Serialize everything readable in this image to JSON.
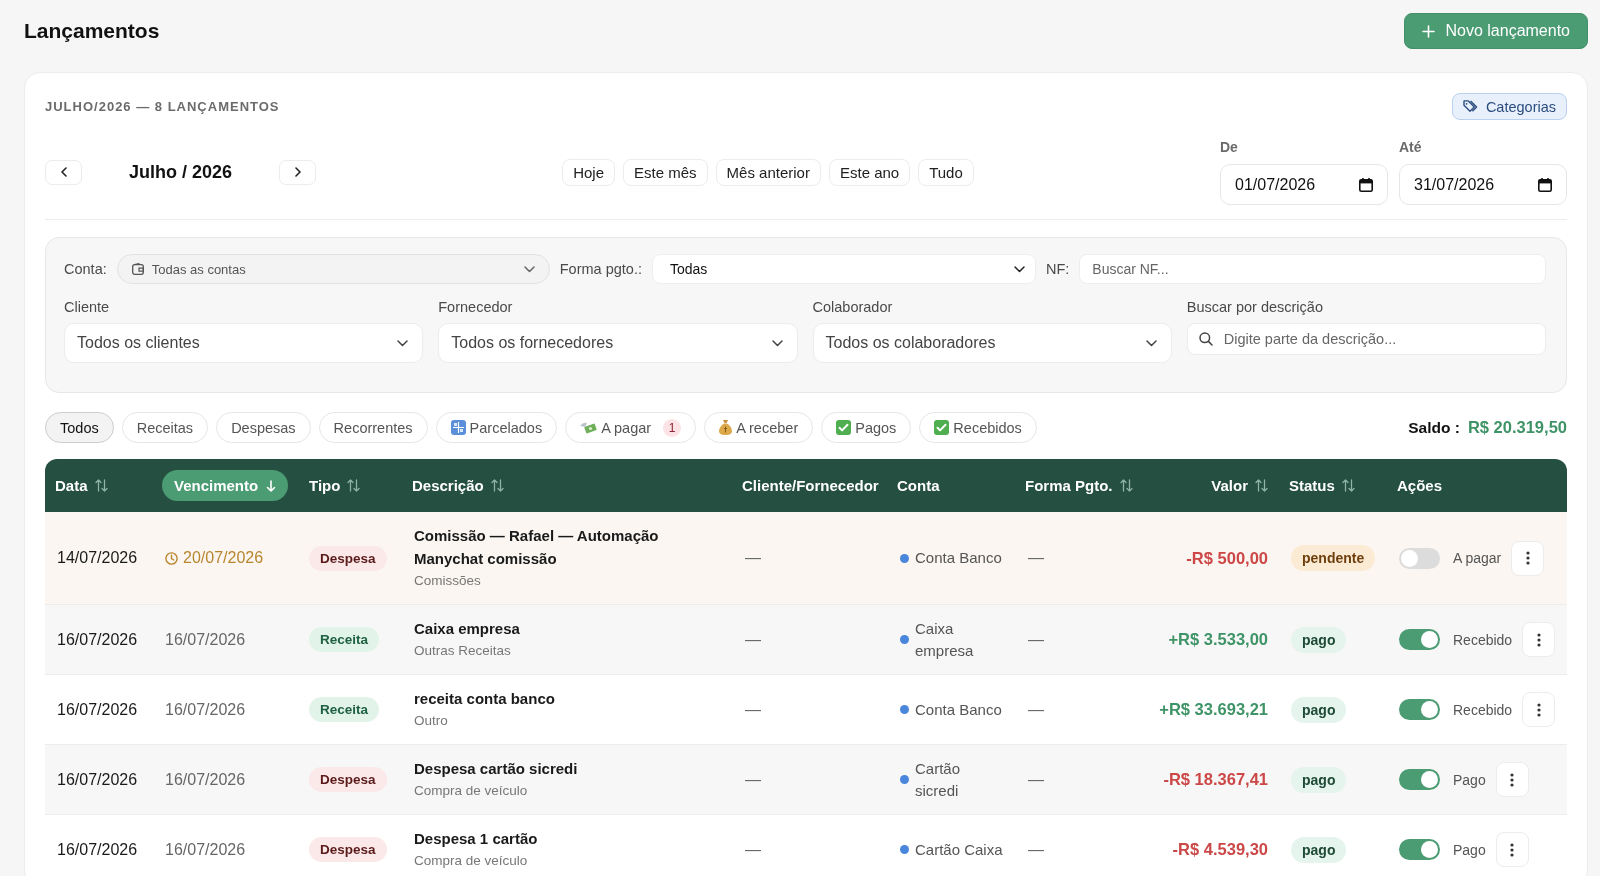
{
  "header": {
    "title": "Lançamentos",
    "new_button": "Novo lançamento"
  },
  "summary": "JULHO/2026 — 8 LANÇAMENTOS",
  "categories_button": "Categorias",
  "period": {
    "label": "Julho / 2026"
  },
  "quick_ranges": [
    "Hoje",
    "Este mês",
    "Mês anterior",
    "Este ano",
    "Tudo"
  ],
  "date_from": {
    "label": "De",
    "value": "01/07/2026"
  },
  "date_to": {
    "label": "Até",
    "value": "31/07/2026"
  },
  "filters": {
    "conta": {
      "label": "Conta:",
      "value": "Todas as contas"
    },
    "forma_pgto": {
      "label": "Forma pgto.:",
      "value": "Todas"
    },
    "nf": {
      "label": "NF:",
      "placeholder": "Buscar NF..."
    },
    "selects": [
      {
        "label": "Cliente",
        "value": "Todos os clientes"
      },
      {
        "label": "Fornecedor",
        "value": "Todos os fornecedores"
      },
      {
        "label": "Colaborador",
        "value": "Todos os colaboradores"
      }
    ],
    "busca": {
      "label": "Buscar por descrição",
      "placeholder": "Digite parte da descrição..."
    }
  },
  "chips": [
    {
      "label": "Todos",
      "kind": "plain",
      "selected": true
    },
    {
      "label": "Receitas",
      "kind": "plain",
      "selected": false
    },
    {
      "label": "Despesas",
      "kind": "plain",
      "selected": false
    },
    {
      "label": "Recorrentes",
      "kind": "plain",
      "selected": false
    },
    {
      "label": "Parcelados",
      "kind": "numbers",
      "selected": false
    },
    {
      "label": "A pagar",
      "kind": "money-wings",
      "selected": false,
      "badge": "1"
    },
    {
      "label": "A receber",
      "kind": "money-bag",
      "selected": false
    },
    {
      "label": "Pagos",
      "kind": "check",
      "selected": false
    },
    {
      "label": "Recebidos",
      "kind": "check",
      "selected": false
    }
  ],
  "saldo": {
    "label": "Saldo :",
    "value": "R$ 20.319,50"
  },
  "table": {
    "columns": [
      {
        "label": "Data",
        "sortable": true,
        "selected": false
      },
      {
        "label": "Vencimento",
        "sortable": true,
        "selected": true
      },
      {
        "label": "Tipo",
        "sortable": true,
        "selected": false
      },
      {
        "label": "Descrição",
        "sortable": true,
        "selected": false
      },
      {
        "label": "Cliente/Fornecedor",
        "sortable": false,
        "selected": false
      },
      {
        "label": "Conta",
        "sortable": false,
        "selected": false
      },
      {
        "label": "Forma Pgto.",
        "sortable": true,
        "selected": false
      },
      {
        "label": "Valor",
        "sortable": true,
        "selected": false
      },
      {
        "label": "Status",
        "sortable": true,
        "selected": false
      },
      {
        "label": "Ações",
        "sortable": false,
        "selected": false
      }
    ],
    "rows": [
      {
        "data": "14/07/2026",
        "vencimento": "20/07/2026",
        "alert": true,
        "kind": "expense",
        "tipo": "Despesa",
        "descricao": "Comissão — Rafael — Automação Manychat comissão",
        "categoria": "Comissões",
        "cliente_fornecedor": "—",
        "conta": "Conta Banco",
        "forma_pgto": "—",
        "valor": "-R$ 500,00",
        "status": {
          "label": "pendente",
          "kind": "pending"
        },
        "paid": false,
        "acao": "A pagar"
      },
      {
        "data": "16/07/2026",
        "vencimento": "16/07/2026",
        "alert": false,
        "kind": "income",
        "tipo": "Receita",
        "descricao": "Caixa empresa",
        "categoria": "Outras Receitas",
        "cliente_fornecedor": "—",
        "conta": "Caixa empresa",
        "forma_pgto": "—",
        "valor": "+R$ 3.533,00",
        "status": {
          "label": "pago",
          "kind": "paid"
        },
        "paid": true,
        "acao": "Recebido"
      },
      {
        "data": "16/07/2026",
        "vencimento": "16/07/2026",
        "alert": false,
        "kind": "income",
        "tipo": "Receita",
        "descricao": "receita conta banco",
        "categoria": "Outro",
        "cliente_fornecedor": "—",
        "conta": "Conta Banco",
        "forma_pgto": "—",
        "valor": "+R$ 33.693,21",
        "status": {
          "label": "pago",
          "kind": "paid"
        },
        "paid": true,
        "acao": "Recebido"
      },
      {
        "data": "16/07/2026",
        "vencimento": "16/07/2026",
        "alert": false,
        "kind": "expense",
        "tipo": "Despesa",
        "descricao": "Despesa cartão sicredi",
        "categoria": "Compra de veículo",
        "cliente_fornecedor": "—",
        "conta": "Cartão sicredi",
        "forma_pgto": "—",
        "valor": "-R$ 18.367,41",
        "status": {
          "label": "pago",
          "kind": "paid"
        },
        "paid": true,
        "acao": "Pago"
      },
      {
        "data": "16/07/2026",
        "vencimento": "16/07/2026",
        "alert": false,
        "kind": "expense",
        "tipo": "Despesa",
        "descricao": "Despesa 1 cartão",
        "categoria": "Compra de veículo",
        "cliente_fornecedor": "—",
        "conta": "Cartão Caixa",
        "forma_pgto": "—",
        "valor": "-R$ 4.539,30",
        "status": {
          "label": "pago",
          "kind": "paid"
        },
        "paid": true,
        "acao": "Pago"
      }
    ]
  }
}
